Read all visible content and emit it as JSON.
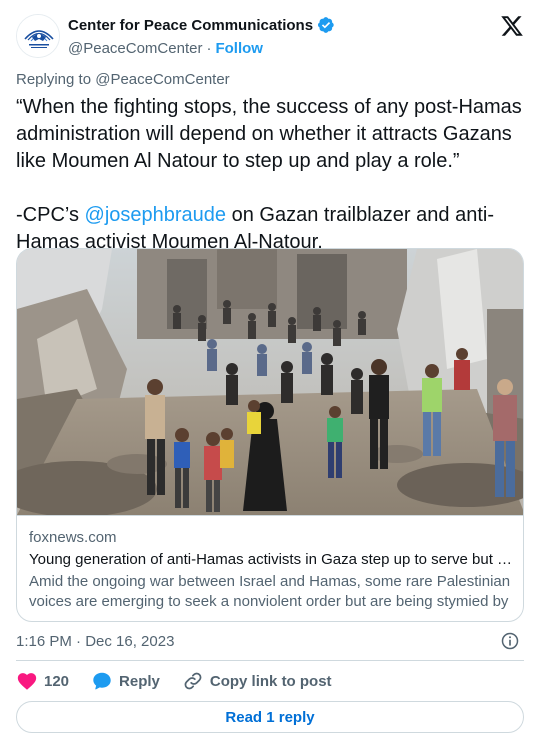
{
  "author": {
    "name": "Center for Peace Communications",
    "handle": "@PeaceComCenter",
    "separator": "·",
    "follow_label": "Follow"
  },
  "reply_to": "Replying to @PeaceComCenter",
  "tweet": {
    "text_part1": "“When the fighting stops, the success of any post-Hamas administration will depend on whether it attracts Gazans like Moumen Al Natour to step up and play a role.”\n\n-CPC’s ",
    "mention": "@josephbraude",
    "text_part2": " on Gazan trailblazer and anti-Hamas activist Moumen Al-Natour."
  },
  "link_card": {
    "domain": "foxnews.com",
    "title": "Young generation of anti-Hamas activists in Gaza step up to serve but hope for an end to Hamas",
    "description": "Amid the ongoing war between Israel and Hamas, some rare Palestinian voices are emerging to seek a nonviolent order but are being stymied by Hamas."
  },
  "timestamp": "1:16 PM · Dec 16, 2023",
  "actions": {
    "likes": "120",
    "reply_label": "Reply",
    "copy_label": "Copy link to post"
  },
  "read_replies_label": "Read 1 reply",
  "colors": {
    "accent": "#1d9bf0",
    "like": "#f91880",
    "text": "#0f1419",
    "secondary": "#536471",
    "border": "#cfd9de"
  }
}
